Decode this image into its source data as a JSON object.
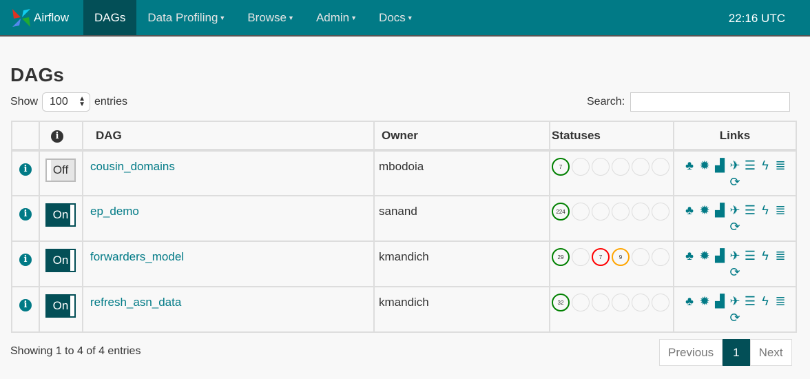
{
  "nav": {
    "brand": "Airflow",
    "items": [
      {
        "label": "DAGs",
        "active": true,
        "caret": false
      },
      {
        "label": "Data Profiling",
        "caret": true
      },
      {
        "label": "Browse",
        "caret": true
      },
      {
        "label": "Admin",
        "caret": true
      },
      {
        "label": "Docs",
        "caret": true
      }
    ],
    "clock": "22:16 UTC"
  },
  "page": {
    "title": "DAGs",
    "show_label": "Show",
    "entries_value": "100",
    "entries_label": "entries",
    "search_label": "Search:",
    "search_value": ""
  },
  "table": {
    "headers": [
      "",
      "i",
      "DAG",
      "Owner",
      "Statuses",
      "Links"
    ],
    "rows": [
      {
        "toggle": "Off",
        "dag": "cousin_domains",
        "owner": "mbodoia",
        "statuses": [
          {
            "v": "7",
            "color": "#008000"
          },
          {
            "v": ""
          },
          {
            "v": ""
          },
          {
            "v": ""
          },
          {
            "v": ""
          },
          {
            "v": ""
          }
        ]
      },
      {
        "toggle": "On",
        "dag": "ep_demo",
        "owner": "sanand",
        "statuses": [
          {
            "v": "224",
            "color": "#008000"
          },
          {
            "v": ""
          },
          {
            "v": ""
          },
          {
            "v": ""
          },
          {
            "v": ""
          },
          {
            "v": ""
          }
        ]
      },
      {
        "toggle": "On",
        "dag": "forwarders_model",
        "owner": "kmandich",
        "statuses": [
          {
            "v": "29",
            "color": "#008000"
          },
          {
            "v": ""
          },
          {
            "v": "7",
            "color": "#ff0000"
          },
          {
            "v": "9",
            "color": "#ffa500"
          },
          {
            "v": ""
          },
          {
            "v": ""
          }
        ]
      },
      {
        "toggle": "On",
        "dag": "refresh_asn_data",
        "owner": "kmandich",
        "statuses": [
          {
            "v": "32",
            "color": "#008000"
          },
          {
            "v": ""
          },
          {
            "v": ""
          },
          {
            "v": ""
          },
          {
            "v": ""
          },
          {
            "v": ""
          }
        ]
      }
    ],
    "link_icons": [
      "tree-icon",
      "graph-icon",
      "bar-chart-icon",
      "plane-icon",
      "gantt-icon",
      "bolt-icon",
      "list-icon",
      "refresh-icon"
    ]
  },
  "footer": {
    "info": "Showing 1 to 4 of 4 entries",
    "prev": "Previous",
    "page": "1",
    "next": "Next"
  },
  "colors": {
    "nav": "#017a86",
    "active": "#034f57",
    "success": "#008000",
    "failed": "#ff0000",
    "retry": "#ffa500"
  }
}
